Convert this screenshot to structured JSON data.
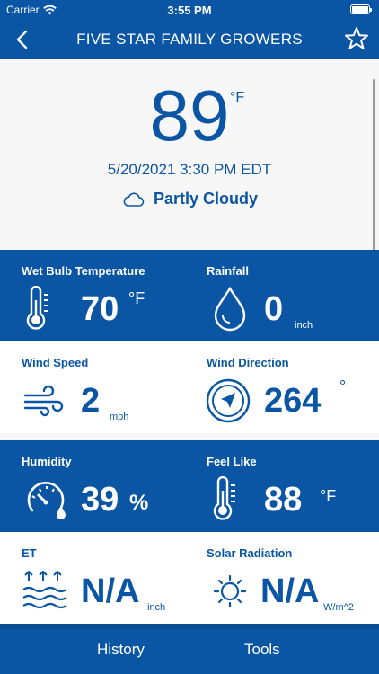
{
  "status_bar": {
    "carrier": "Carrier",
    "time": "3:55 PM"
  },
  "nav": {
    "title": "FIVE STAR FAMILY GROWERS",
    "back_icon": "chevron-left-icon",
    "favorite_icon": "star-outline-icon"
  },
  "current": {
    "temperature": "89",
    "temperature_unit": "°F",
    "datetime": "5/20/2021 3:30 PM EDT",
    "condition": "Partly Cloudy",
    "condition_icon": "cloud-icon"
  },
  "metrics": [
    {
      "label": "Wet Bulb Temperature",
      "value": "70",
      "unit": "°F",
      "icon": "thermometer-icon"
    },
    {
      "label": "Rainfall",
      "value": "0",
      "unit": "inch",
      "icon": "water-drop-icon"
    },
    {
      "label": "Wind Speed",
      "value": "2",
      "unit": "mph",
      "icon": "wind-icon"
    },
    {
      "label": "Wind Direction",
      "value": "264",
      "unit": "°",
      "icon": "compass-icon"
    },
    {
      "label": "Humidity",
      "value": "39",
      "unit": "%",
      "icon": "humidity-gauge-icon"
    },
    {
      "label": "Feel Like",
      "value": "88",
      "unit": "°F",
      "icon": "thermometer-icon"
    },
    {
      "label": "ET",
      "value": "N/A",
      "unit": "inch",
      "icon": "evapotranspiration-icon"
    },
    {
      "label": "Solar Radiation",
      "value": "N/A",
      "unit": "W/m^2",
      "icon": "sun-icon"
    }
  ],
  "tabs": [
    {
      "label": "History"
    },
    {
      "label": "Tools"
    }
  ],
  "colors": {
    "primary": "#0b56a4",
    "background": "#f7f7f7",
    "panel_white": "#ffffff"
  }
}
